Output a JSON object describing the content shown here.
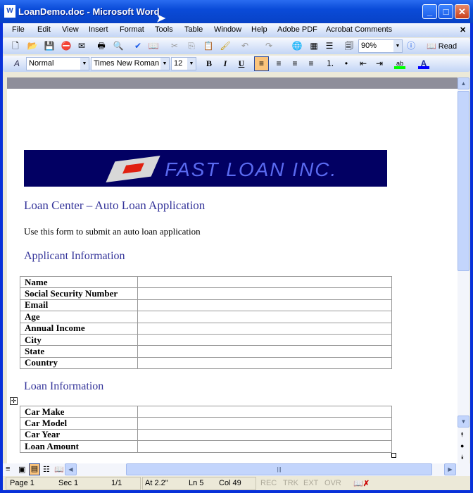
{
  "window": {
    "title": "LoanDemo.doc - Microsoft Word",
    "app_icon": "word-doc-icon"
  },
  "menu": [
    "File",
    "Edit",
    "View",
    "Insert",
    "Format",
    "Tools",
    "Table",
    "Window",
    "Help",
    "Adobe PDF",
    "Acrobat Comments"
  ],
  "toolbar": {
    "zoom": "90%",
    "read_label": "Read"
  },
  "formatting": {
    "style": "Normal",
    "font": "Times New Roman",
    "size": "12",
    "highlight_color": "#00ff00",
    "font_color": "#0000ff"
  },
  "document": {
    "logo_text": "FAST LOAN INC.",
    "title": "Loan Center – Auto Loan Application",
    "intro": "Use this form to submit an auto loan application",
    "applicant_heading": "Applicant Information",
    "applicant_fields": [
      "Name",
      "Social Security Number",
      "Email",
      "Age",
      "Annual Income",
      "City",
      "State",
      "Country"
    ],
    "loan_heading": "Loan Information",
    "loan_fields": [
      "Car Make",
      "Car Model",
      "Car Year",
      "Loan Amount"
    ]
  },
  "status": {
    "page": "Page 1",
    "sec": "Sec 1",
    "pages": "1/1",
    "at": "At 2.2\"",
    "ln": "Ln 5",
    "col": "Col 49",
    "rec": "REC",
    "trk": "TRK",
    "ext": "EXT",
    "ovr": "OVR"
  }
}
